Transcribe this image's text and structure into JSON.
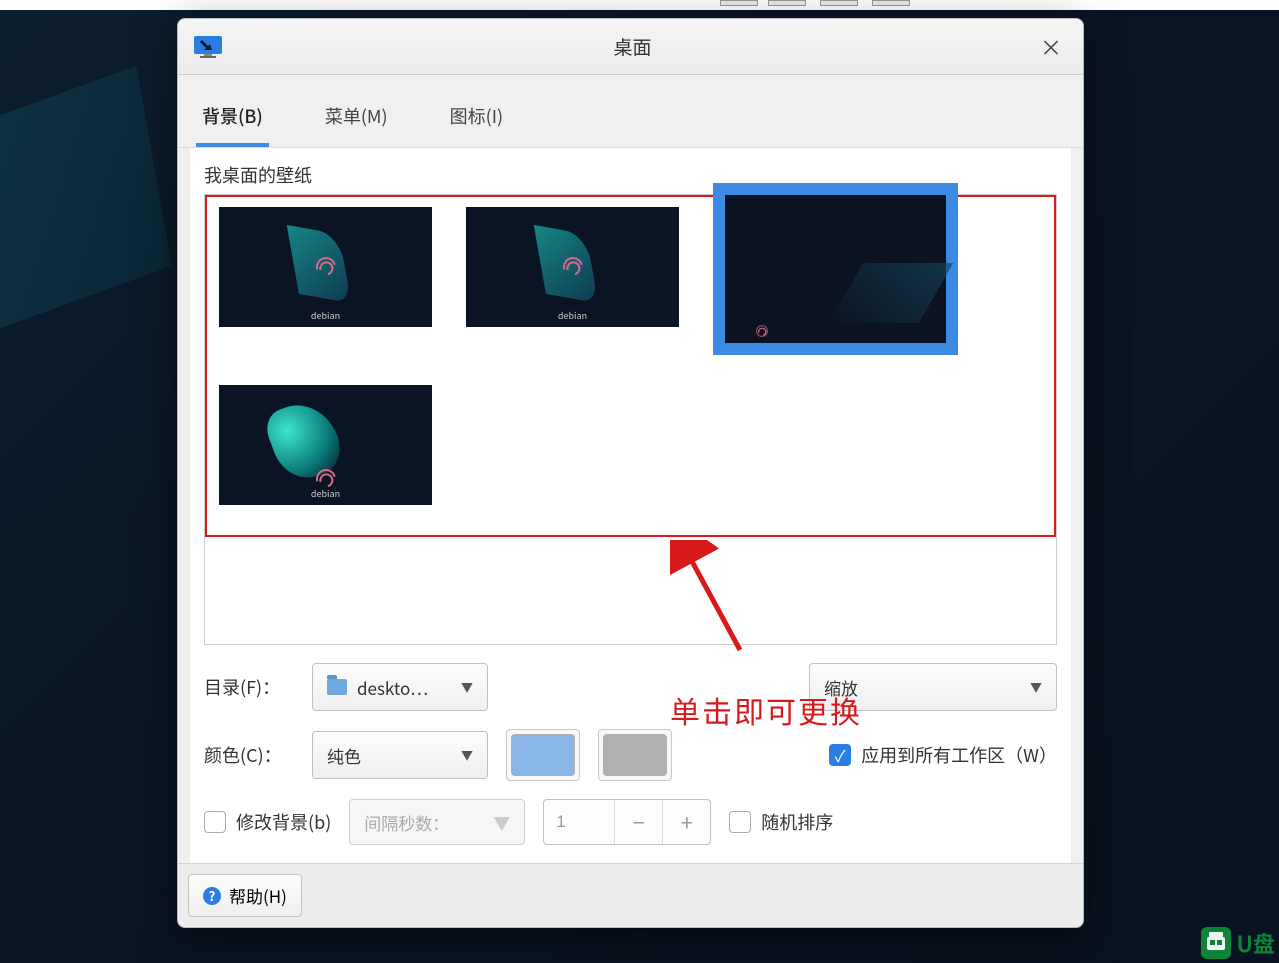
{
  "titlebar": {
    "title": "桌面",
    "close_label": "×"
  },
  "tabs": [
    {
      "label": "背景(B)",
      "active": true
    },
    {
      "label": "菜单(M)",
      "active": false
    },
    {
      "label": "图标(I)",
      "active": false
    }
  ],
  "section": {
    "wallpapers_label": "我桌面的壁纸"
  },
  "annotation": {
    "text": "单击即可更换"
  },
  "controls": {
    "directory_label": "目录(F)：",
    "directory_value": "deskto…",
    "style_value": "缩放",
    "color_label": "颜色(C)：",
    "color_value": "纯色",
    "apply_all_label": "应用到所有工作区（W）",
    "modify_bg_label": "修改背景(b)",
    "interval_label": "间隔秒数：",
    "interval_value": "1",
    "random_label": "随机排序"
  },
  "footer": {
    "help_label": "帮助(H)"
  },
  "watermark": {
    "text": "U盘"
  }
}
